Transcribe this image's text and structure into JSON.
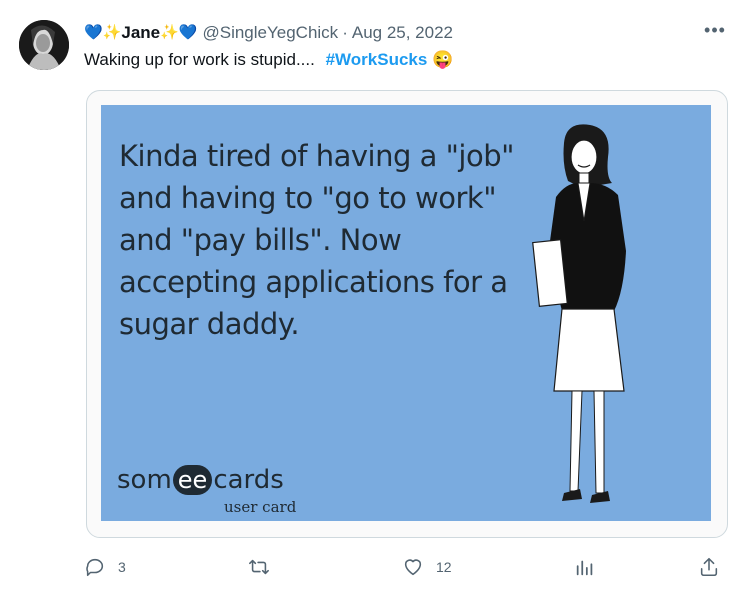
{
  "author": {
    "name": "Jane",
    "emoji_left": "💙✨",
    "emoji_right": "✨💙",
    "handle": "@SingleYegChick",
    "separator": "·",
    "date": "Aug 25, 2022"
  },
  "more_label": "•••",
  "tweet": {
    "text": "Waking up for work is stupid....",
    "hashtag": "#WorkSucks",
    "emoji": "😜"
  },
  "media": {
    "card_text": "Kinda tired of having a \"job\" and having to \"go to work\" and \"pay bills\". Now accepting applications for a sugar daddy.",
    "logo_left": "som",
    "logo_mid": "ee",
    "logo_right": "cards",
    "logo_sub": "user card",
    "background_color": "#7aabdf"
  },
  "actions": {
    "reply_count": "3",
    "retweet_count": "",
    "like_count": "12",
    "icons": [
      "reply-icon",
      "retweet-icon",
      "like-icon",
      "analytics-icon",
      "share-icon"
    ]
  },
  "colors": {
    "accent": "#1d9bf0",
    "muted": "#536471",
    "text": "#0f1419",
    "border": "#cfd9de"
  }
}
